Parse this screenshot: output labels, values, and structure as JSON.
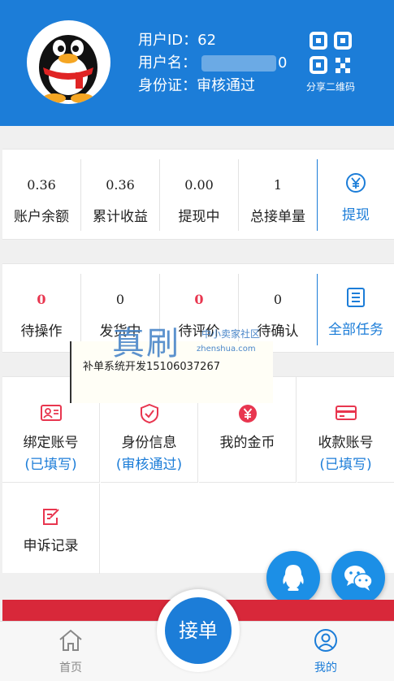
{
  "profile": {
    "id_label": "用户ID：",
    "id_value": "62",
    "name_label": "用户名：",
    "name_value_suffix": "0",
    "idcard_label": "身份证：",
    "idcard_value": "审核通过",
    "qr_label": "分享二维码"
  },
  "stats": [
    {
      "value": "0.36",
      "label": "账户余额"
    },
    {
      "value": "0.36",
      "label": "累计收益"
    },
    {
      "value": "0.00",
      "label": "提现中"
    },
    {
      "value": "1",
      "label": "总接单量"
    }
  ],
  "withdraw": {
    "label": "提现",
    "icon": "yen-circle-icon"
  },
  "tasks": [
    {
      "value": "0",
      "label": "待操作"
    },
    {
      "value": "0",
      "label": "发货中"
    },
    {
      "value": "0",
      "label": "待评价"
    },
    {
      "value": "0",
      "label": "待确认"
    }
  ],
  "all_tasks": {
    "label": "全部任务",
    "icon": "list-icon"
  },
  "watermark": {
    "big": "真刷",
    "small": "中小卖家社区",
    "domain": "zhenshua.com",
    "text": "补单系统开发15106037267"
  },
  "grid": [
    {
      "label": "绑定账号",
      "sub": "(已填写)",
      "icon": "account-card-icon"
    },
    {
      "label": "身份信息",
      "sub": "(审核通过)",
      "icon": "shield-check-icon"
    },
    {
      "label": "我的金币",
      "sub": "",
      "icon": "coin-icon"
    },
    {
      "label": "收款账号",
      "sub": "(已填写)",
      "icon": "bank-card-icon"
    },
    {
      "label": "申诉记录",
      "sub": "",
      "icon": "edit-note-icon"
    }
  ],
  "center_button": {
    "label": "接单"
  },
  "tabs": [
    {
      "label": "首页",
      "icon": "home-icon"
    },
    {
      "label": "我的",
      "icon": "user-icon"
    }
  ],
  "colors": {
    "primary": "#1c7dd8",
    "accent_red": "#e8364f",
    "banner_red": "#d8283a"
  }
}
